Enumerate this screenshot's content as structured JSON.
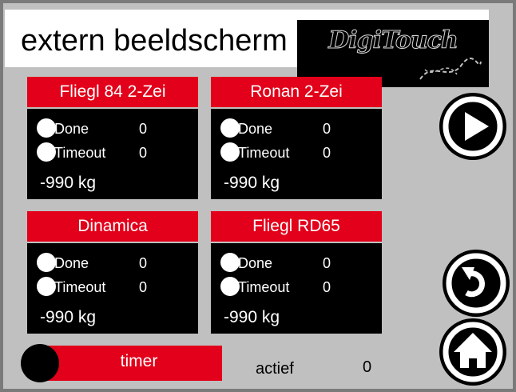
{
  "header": {
    "title": "extern beeldscherm",
    "logo_text": "DigiTouch"
  },
  "panels": [
    {
      "name": "Fliegl 84 2-Zei",
      "done_label": "Done",
      "done_value": "0",
      "timeout_label": "Timeout",
      "timeout_value": "0",
      "weight": "-990 kg"
    },
    {
      "name": "Ronan 2-Zei",
      "done_label": "Done",
      "done_value": "0",
      "timeout_label": "Timeout",
      "timeout_value": "0",
      "weight": "-990 kg"
    },
    {
      "name": "Dinamica",
      "done_label": "Done",
      "done_value": "0",
      "timeout_label": "Timeout",
      "timeout_value": "0",
      "weight": "-990 kg"
    },
    {
      "name": "Fliegl RD65",
      "done_label": "Done",
      "done_value": "0",
      "timeout_label": "Timeout",
      "timeout_value": "0",
      "weight": "-990 kg"
    }
  ],
  "footer": {
    "timer_label": "timer",
    "actief_label": "actief",
    "actief_value": "0"
  },
  "buttons": {
    "play": "play-icon",
    "back": "undo-icon",
    "home": "home-icon"
  },
  "colors": {
    "accent_red": "#e2001a",
    "panel_black": "#000000",
    "background_gray": "#c0c0c0"
  }
}
